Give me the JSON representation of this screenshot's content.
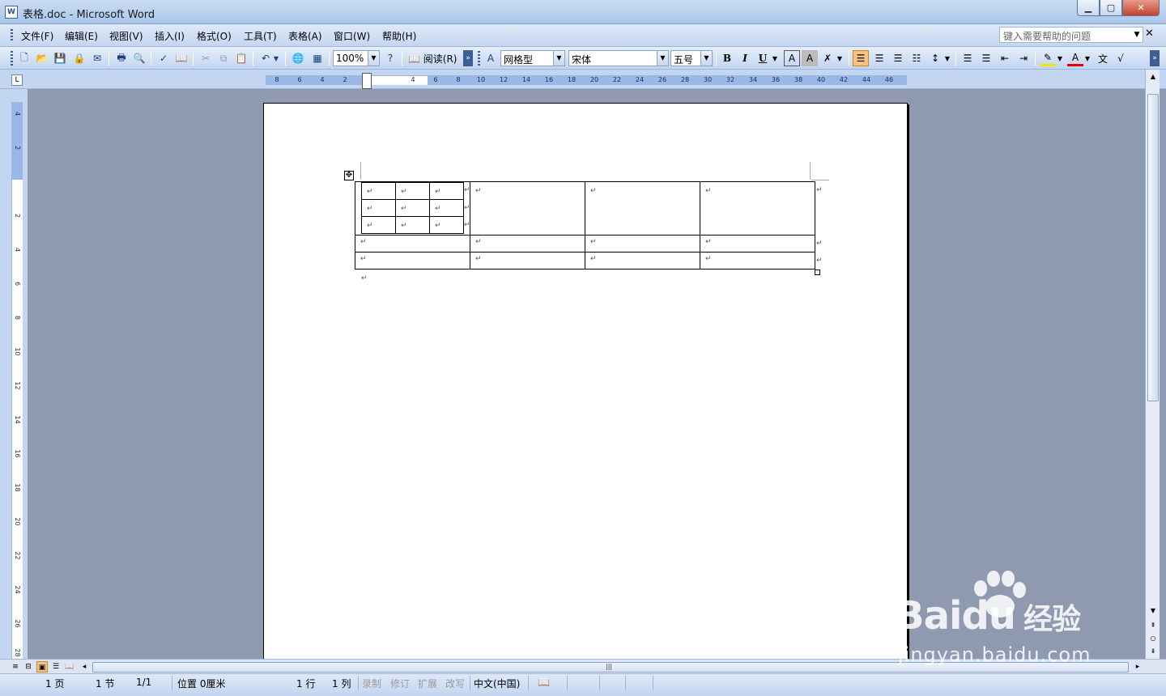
{
  "window": {
    "title": "表格.doc - Microsoft Word",
    "app_icon": "W"
  },
  "menu": {
    "items": [
      "文件(F)",
      "编辑(E)",
      "视图(V)",
      "插入(I)",
      "格式(O)",
      "工具(T)",
      "表格(A)",
      "窗口(W)",
      "帮助(H)"
    ],
    "help_placeholder": "键入需要帮助的问题"
  },
  "toolbar": {
    "zoom": "100%",
    "read_label": "阅读(R)",
    "style": "网格型",
    "font": "宋体",
    "size": "五号",
    "bold": "B",
    "italic": "I",
    "underline": "U"
  },
  "ruler": {
    "h_ticks": [
      "8",
      "6",
      "4",
      "2",
      "",
      "",
      "4",
      "6",
      "8",
      "10",
      "12",
      "14",
      "16",
      "18",
      "20",
      "22",
      "24",
      "26",
      "28",
      "30",
      "32",
      "34",
      "36",
      "38",
      "40",
      "42",
      "44",
      "46"
    ],
    "v_ticks": [
      "4",
      "2",
      "",
      "2",
      "4",
      "6",
      "8",
      "10",
      "12",
      "14",
      "16",
      "18",
      "20",
      "22",
      "24",
      "26",
      "28"
    ]
  },
  "document": {
    "paragraph_mark": "↵",
    "table": {
      "columns": 4,
      "rows": 3,
      "nested_rows": 3,
      "nested_cols": 3
    }
  },
  "statusbar": {
    "page": "1 页",
    "section": "1 节",
    "pages": "1/1",
    "position": "位置 0厘米",
    "line": "1 行",
    "col": "1 列",
    "rec": "录制",
    "trk": "修订",
    "ext": "扩展",
    "ovr": "改写",
    "lang": "中文(中国)"
  },
  "watermark": {
    "brand": "Bai",
    "brand2": "du",
    "cn": "经验",
    "url": "jingyan.baidu.com"
  }
}
